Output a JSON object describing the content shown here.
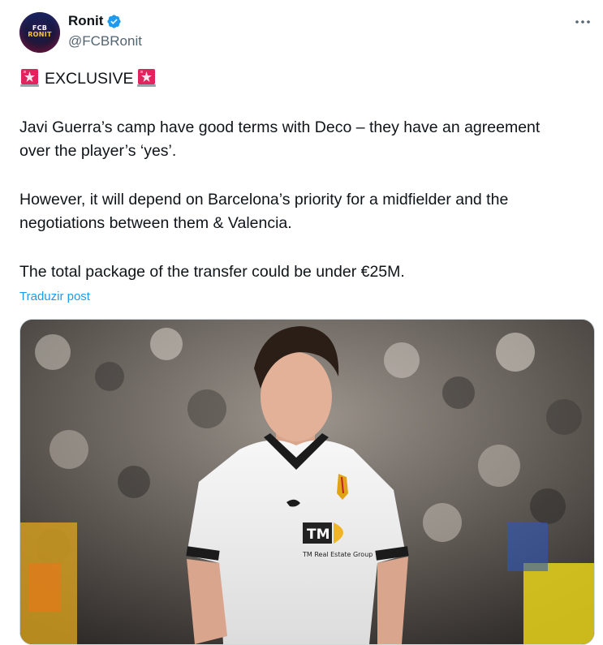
{
  "author": {
    "display_name": "Ronit",
    "handle": "@FCBRonit",
    "verified": true,
    "avatar_text_line1": "FCB",
    "avatar_text_line2": "RONIT"
  },
  "tweet": {
    "header_word": "EXCLUSIVE",
    "lines": [
      "Javi Guerra’s camp have good terms with Deco – they have an agreement",
      "over the player’s ‘yes’.",
      "However, it will depend on Barcelona’s priority for a midfielder and the",
      "negotiations between them & Valencia.",
      "The total package of the transfer could be under €25M."
    ],
    "translate_label": "Traduzir post"
  },
  "media": {
    "jersey_sponsor_logo": "TM",
    "jersey_sponsor_text": "TM Real Estate Group"
  },
  "icons": {
    "more": "more-options-icon",
    "verified": "verified-badge-icon",
    "siren": "rotating-light-icon"
  },
  "colors": {
    "accent": "#1d9bf0",
    "text": "#0f1419",
    "secondary": "#536471"
  }
}
